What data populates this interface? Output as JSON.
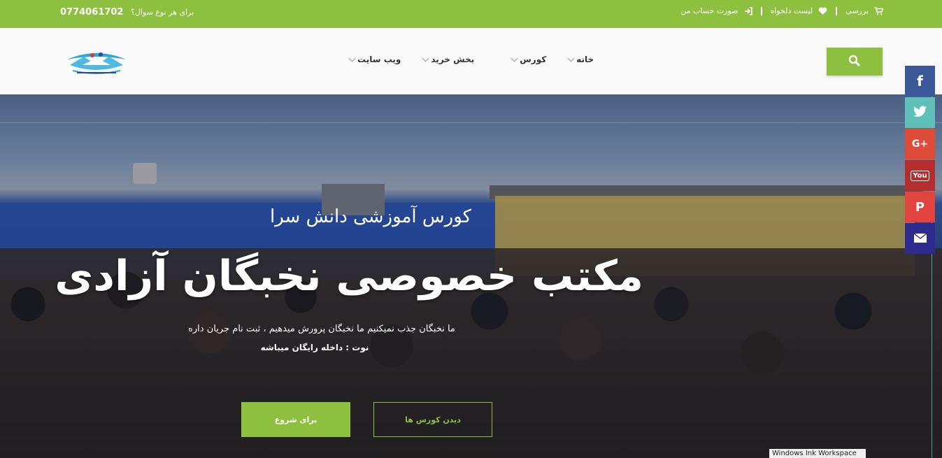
{
  "topbar": {
    "phone": "0774061702",
    "question": "برای هر نوع سوال؟",
    "links": [
      {
        "label": "بررسی",
        "icon": "cart-icon"
      },
      {
        "label": "لیست دلخواه",
        "icon": "heart-icon"
      },
      {
        "label": "صورت حساب من",
        "icon": "sign-in-icon"
      }
    ]
  },
  "colors": {
    "accent": "#8dc03f",
    "facebook": "#3b5998",
    "twitter": "#5fc0b9",
    "googleplus": "#dd4b39",
    "youtube": "#b52d2d",
    "pinterest": "#e1433e",
    "email": "#2d2c8e"
  },
  "nav": {
    "items": [
      {
        "label": "خانه"
      },
      {
        "label": "کورس"
      },
      {
        "label": "بخش خرید"
      },
      {
        "label": "ویب سایت"
      }
    ]
  },
  "hero": {
    "subtitle": "کورس آموزشی دانش سرا",
    "title": "مکتب خصوصی نخبگان آزادی",
    "description": "ما نخبگان جذب نمیکنیم ما نخبگان پرورش میدهیم ، ثبت نام جریان داره",
    "note": "نوت : داخله رایگان میباشه",
    "start_button": "برای شروع",
    "courses_button": "دیدن کورس ها"
  },
  "social": [
    {
      "name": "facebook",
      "glyph": "f"
    },
    {
      "name": "twitter",
      "glyph": "t"
    },
    {
      "name": "googleplus",
      "glyph": "G+"
    },
    {
      "name": "youtube",
      "glyph": "You"
    },
    {
      "name": "pinterest",
      "glyph": "P"
    },
    {
      "name": "email",
      "glyph": ""
    }
  ],
  "taskbar": {
    "ink_workspace": "Windows Ink Workspace"
  }
}
